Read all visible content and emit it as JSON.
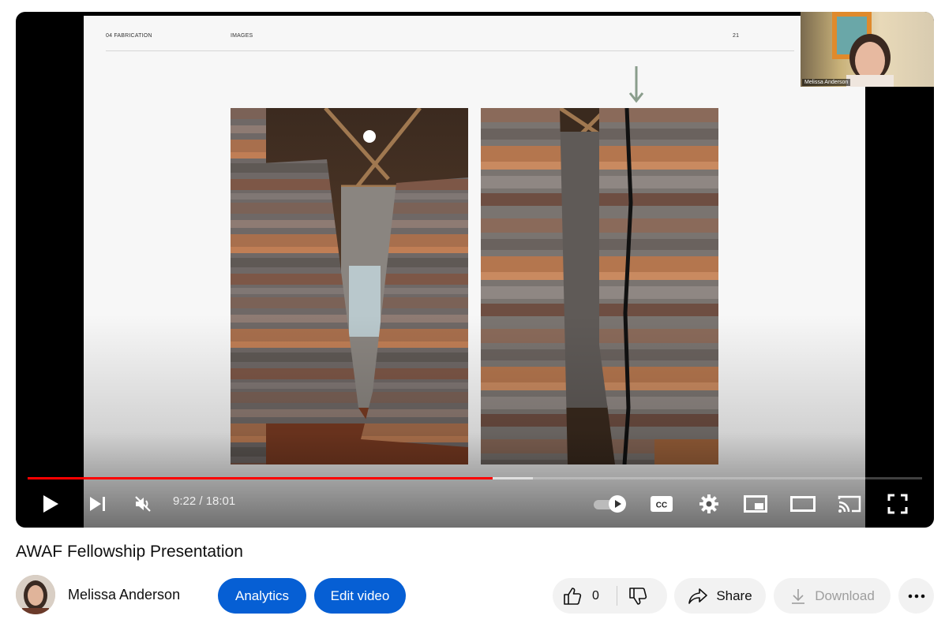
{
  "slide": {
    "section": "04 FABRICATION",
    "category": "IMAGES",
    "page_number": "21"
  },
  "webcam": {
    "name": "Melissa Anderson"
  },
  "player": {
    "current_time": "9:22",
    "duration": "18:01",
    "time_display": "9:22 / 18:01",
    "played_fraction": 0.52,
    "buffered_fraction": 0.565,
    "cc_label": "CC"
  },
  "video": {
    "title": "AWAF Fellowship Presentation",
    "channel": "Melissa Anderson",
    "analytics_label": "Analytics",
    "edit_label": "Edit video",
    "like_count": "0",
    "share_label": "Share",
    "download_label": "Download"
  },
  "icons": {
    "play": "play-icon",
    "next": "next-icon",
    "mute": "muted-speaker-icon",
    "autoplay": "autoplay-toggle-icon",
    "captions": "captions-icon",
    "settings": "gear-icon",
    "miniplayer": "miniplayer-icon",
    "theater": "theater-icon",
    "cast": "cast-icon",
    "fullscreen": "fullscreen-icon",
    "like": "thumbs-up-icon",
    "dislike": "thumbs-down-icon",
    "share": "share-arrow-icon",
    "download": "download-icon",
    "more": "more-dots-icon"
  },
  "colors": {
    "progress_played": "#ff0000",
    "button_blue": "#065fd4",
    "pill_grey": "#f2f2f2"
  }
}
